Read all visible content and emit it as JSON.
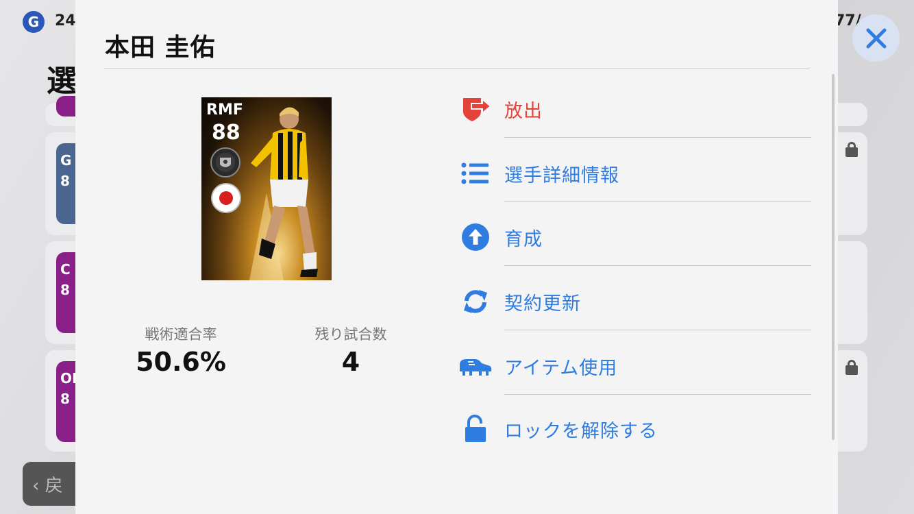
{
  "background": {
    "coin_label": "G",
    "coin_value": "24",
    "top_right_value": "77/",
    "page_title_partial": "選",
    "cards": [
      {
        "position": "G",
        "rating": "8",
        "color": "#4a6590"
      },
      {
        "position": "C",
        "rating": "8",
        "color": "#8a1f8a"
      },
      {
        "position": "ON",
        "rating": "8",
        "color": "#8a1f8a"
      }
    ],
    "back_label": "戻"
  },
  "modal": {
    "title": "本田 圭佑",
    "player_card": {
      "position": "RMF",
      "overall": "88",
      "nationality_flag": "japan-flag"
    },
    "stats": [
      {
        "label": "戦術適合率",
        "value": "50.6%"
      },
      {
        "label": "残り試合数",
        "value": "4"
      }
    ],
    "menu": [
      {
        "icon": "release-icon",
        "label": "放出",
        "color": "#e4433b"
      },
      {
        "icon": "list-icon",
        "label": "選手詳細情報",
        "color": "#2f7de1"
      },
      {
        "icon": "arrow-up-circle-icon",
        "label": "育成",
        "color": "#2f7de1"
      },
      {
        "icon": "refresh-icon",
        "label": "契約更新",
        "color": "#2f7de1"
      },
      {
        "icon": "boot-icon",
        "label": "アイテム使用",
        "color": "#2f7de1"
      },
      {
        "icon": "unlock-icon",
        "label": "ロックを解除する",
        "color": "#2f7de1"
      }
    ]
  },
  "close_button": {
    "icon": "close-icon",
    "color": "#2f7de1"
  }
}
